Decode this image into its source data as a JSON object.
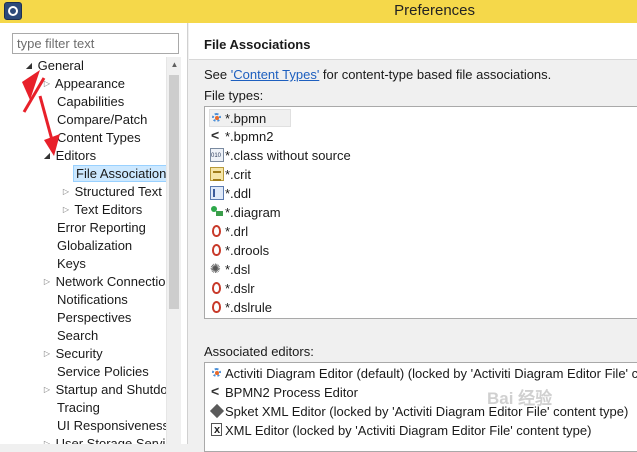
{
  "window": {
    "title": "Preferences"
  },
  "filter": {
    "placeholder": "type filter text"
  },
  "tree": [
    {
      "label": "General",
      "toggle": "◢",
      "top": 0
    },
    {
      "label": "Appearance",
      "toggle": "▷"
    },
    {
      "label": "Capabilities",
      "toggle": ""
    },
    {
      "label": "Compare/Patch",
      "toggle": ""
    },
    {
      "label": "Content Types",
      "toggle": ""
    },
    {
      "label": "Editors",
      "toggle": "◢"
    },
    {
      "label": "File Associations",
      "toggle": ""
    },
    {
      "label": "Structured Text",
      "toggle": "▷"
    },
    {
      "label": "Text Editors",
      "toggle": "▷"
    },
    {
      "label": "Error Reporting",
      "toggle": ""
    },
    {
      "label": "Globalization",
      "toggle": ""
    },
    {
      "label": "Keys",
      "toggle": ""
    },
    {
      "label": "Network Connections",
      "toggle": "▷"
    },
    {
      "label": "Notifications",
      "toggle": ""
    },
    {
      "label": "Perspectives",
      "toggle": ""
    },
    {
      "label": "Search",
      "toggle": ""
    },
    {
      "label": "Security",
      "toggle": "▷"
    },
    {
      "label": "Service Policies",
      "toggle": ""
    },
    {
      "label": "Startup and Shutdown",
      "toggle": "▷"
    },
    {
      "label": "Tracing",
      "toggle": ""
    },
    {
      "label": "UI Responsiveness",
      "toggle": ""
    },
    {
      "label": "User Storage Service",
      "toggle": "▷"
    }
  ],
  "page": {
    "title": "File Associations",
    "see_prefix": "See ",
    "see_link": "'Content Types'",
    "see_suffix": " for content-type based file associations.",
    "file_types_label": "File types:",
    "editors_label": "Associated editors:"
  },
  "file_types": [
    {
      "label": "*.bpmn",
      "icon": "bpmn-icon"
    },
    {
      "label": "*.bpmn2",
      "icon": "share-icon"
    },
    {
      "label": "*.class without source",
      "icon": "class-file-icon"
    },
    {
      "label": "*.crit",
      "icon": "crit-file-icon"
    },
    {
      "label": "*.ddl",
      "icon": "ddl-file-icon"
    },
    {
      "label": "*.diagram",
      "icon": "diagram-file-icon"
    },
    {
      "label": "*.drl",
      "icon": "drools-icon"
    },
    {
      "label": "*.drools",
      "icon": "drools-icon"
    },
    {
      "label": "*.dsl",
      "icon": "gear-icon"
    },
    {
      "label": "*.dslr",
      "icon": "drools-icon"
    },
    {
      "label": "*.dslrule",
      "icon": "drools-icon"
    }
  ],
  "editors": [
    {
      "label": "Activiti Diagram Editor (default) (locked by 'Activiti Diagram Editor File' content type)",
      "icon": "bpmn-icon"
    },
    {
      "label": "BPMN2 Process Editor",
      "icon": "share-icon"
    },
    {
      "label": "Spket XML Editor (locked by 'Activiti Diagram Editor File' content type)",
      "icon": "spket-icon"
    },
    {
      "label": "XML Editor (locked by 'Activiti Diagram Editor File' content type)",
      "icon": "xml-icon"
    }
  ],
  "watermark": "Bai 经验",
  "colors": {
    "titlebar": "#f5d84a",
    "selection": "#cce8ff",
    "link": "#1d5fbf",
    "arrow": "#e8202a"
  }
}
